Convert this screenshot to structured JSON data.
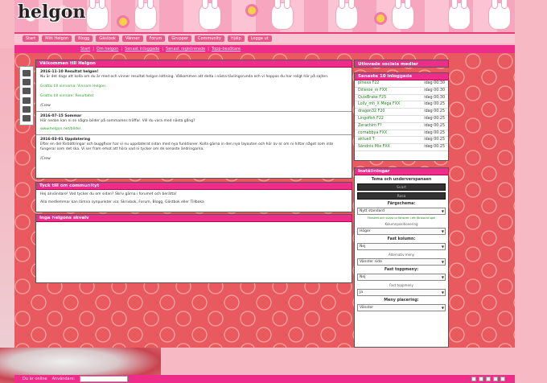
{
  "site": {
    "logo": "helgon"
  },
  "nav_main": [
    "Start",
    "Mitt Helgon",
    "Blogg",
    "Gästbok",
    "Vänner",
    "Forum",
    "Grupper",
    "Community",
    "Hjälp",
    "Logga ut"
  ],
  "nav_sub": [
    "Start",
    "Om helgon",
    "Senast inloggade",
    "Senast registrerade",
    "Topp-besökare"
  ],
  "welcome_panel": {
    "title": "Välkommen till Helgon",
    "posts": [
      {
        "date": "2016-11-10 Resultat helgon!",
        "body": "Nu är det dags att kolla om du är med och vinner resultat helgon lottning. Välkommen att delta i nästa tävlingsrunda och vi hoppas du har roligt här på sajten.",
        "line2": "Grattis till vinnarna: Vinnare Helgon",
        "line3": "Grattis till vinnare: Resultatet",
        "footer": "/Crew"
      },
      {
        "date": "2016-07-15 Sommar",
        "body": "Här nedan kan ni se några bilder på sommarens träffar. Vill du vara med nästa gång?",
        "line2": "www.helgon.net/bilder"
      },
      {
        "date": "2016-03-01 Uppdatering",
        "body": "Efter en del förbättringar och buggfixar har vi nu uppdaterat sidan med nya funktioner. Kolla gärna in den nya layouten och hör av er om ni hittar något som inte fungerar som det ska. Vi ser fram emot att höra vad ni tycker om de senaste ändringarna.",
        "footer": "/Crew"
      }
    ]
  },
  "community_panel": {
    "title": "Tyck till om communityt",
    "body": "Hej användare! Vad tycker du om sidan? Skriv gärna i forumet och berätta!",
    "body2": "Alla medlemmar kan lämna synpunkter via: Skrivbok, Forum, Blogg, Gästbok eller Tillbaka"
  },
  "feed_panel": {
    "title": "Inga helgons skvalv"
  },
  "sidebar": {
    "header": "Utlovade sociala medier",
    "online_title": "Senaste 10 inloggade",
    "online": [
      {
        "user": "pinexa F22",
        "time": "idag 00:30"
      },
      {
        "user": "Dilleroe_m FXX",
        "time": "idag 00:30"
      },
      {
        "user": "QuixBrake F25",
        "time": "idag 00:30"
      },
      {
        "user": "Lolly_mh_X Mega FXX",
        "time": "idag 00:25"
      },
      {
        "user": "dragon32 F20",
        "time": "idag 00:25"
      },
      {
        "user": "Lingofish F22",
        "time": "idag 00:25"
      },
      {
        "user": "Zerachim F?",
        "time": "idag 00:25"
      },
      {
        "user": "cornabbya FXX",
        "time": "idag 00:25"
      },
      {
        "user": "aktuell T",
        "time": "idag 00:25"
      },
      {
        "user": "Sändnix Mix FXX",
        "time": "idag 00:25"
      }
    ]
  },
  "settings": {
    "title": "Inställningar",
    "theme_label": "Tema och underverspanaen",
    "button_dark": "Svart",
    "button_dark2": "Rosa",
    "color_label": "Färgschema:",
    "color_value": "Nytt standard",
    "legend": "Fönstret och svara ut fönstret i ett förstorat spel",
    "column_label": "Kolumnpositionering",
    "column_value": "Höger",
    "fixed_label": "Fast kolumn:",
    "fixed_value": "Nej",
    "theme_pos_label": "Alternativ meny",
    "theme_pos_value": "Vänster sida",
    "fixed_top_label": "Fast toppmeny:",
    "fixed_top_value": "Nej",
    "mini_label": "Fast toppmeny",
    "mini_value": "Ja",
    "menu_label": "Meny placering:",
    "menu_value": "Vänster"
  },
  "bottom_bar": {
    "online_label": "Du är online",
    "search_label": "Användare:"
  },
  "colors": {
    "accent": "#ee2c8a",
    "heart_bg": "#e85a60",
    "link": "#1e7d1e"
  }
}
